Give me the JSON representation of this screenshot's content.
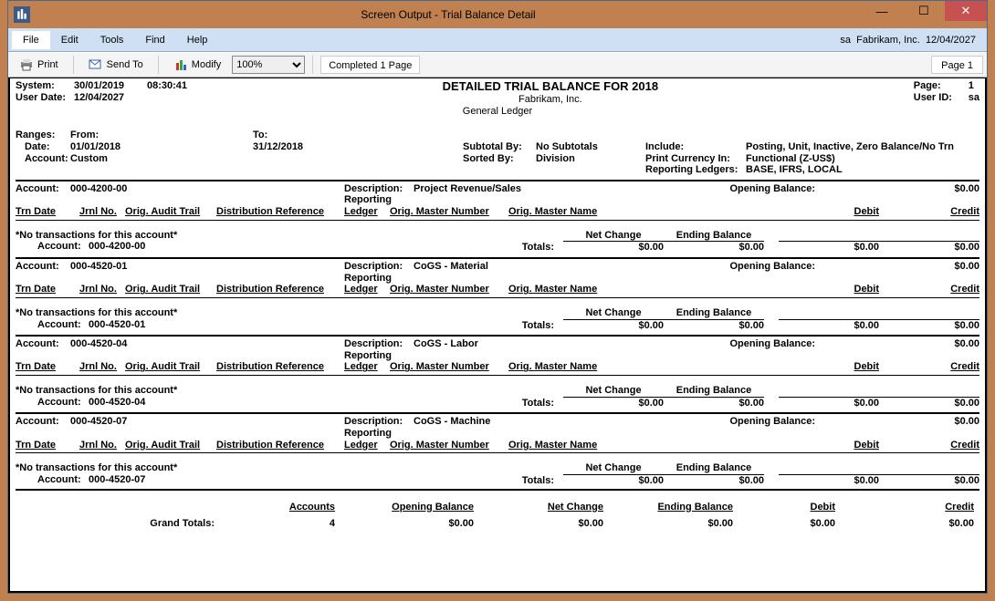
{
  "window": {
    "title": "Screen Output - Trial Balance Detail",
    "min": "—",
    "max": "☐",
    "close": "✕"
  },
  "menubar": {
    "file": "File",
    "edit": "Edit",
    "tools": "Tools",
    "find": "Find",
    "help": "Help",
    "right_user": "sa",
    "right_company": "Fabrikam, Inc.",
    "right_date": "12/04/2027"
  },
  "toolbar": {
    "print": "Print",
    "sendto": "Send To",
    "modify": "Modify",
    "zoom": "100%",
    "status": "Completed 1 Page",
    "pageind": "Page 1"
  },
  "header": {
    "system_lab": "System:",
    "system_date": "30/01/2019",
    "system_time": "08:30:41",
    "userdate_lab": "User Date:",
    "userdate": "12/04/2027",
    "title": "DETAILED TRIAL BALANCE FOR 2018",
    "company": "Fabrikam, Inc.",
    "ledger": "General Ledger",
    "page_lab": "Page:",
    "page": "1",
    "userid_lab": "User ID:",
    "userid": "sa"
  },
  "ranges": {
    "ranges_lab": "Ranges:",
    "from_lab": "From:",
    "to_lab": "To:",
    "date_lab": "Date:",
    "date_from": "01/01/2018",
    "date_to": "31/12/2018",
    "account_lab": "Account:",
    "account_val": "Custom",
    "subtotal_lab": "Subtotal By:",
    "subtotal_val": "No Subtotals",
    "sorted_lab": "Sorted By:",
    "sorted_val": "Division",
    "include_lab": "Include:",
    "include_val": "Posting, Unit, Inactive, Zero Balance/No Trn",
    "curr_lab": "Print Currency In:",
    "curr_val": "Functional (Z-US$)",
    "rl_lab": "Reporting Ledgers:",
    "rl_val": "BASE, IFRS, LOCAL"
  },
  "colheads": {
    "account": "Account:",
    "trn_date": "Trn Date",
    "jrnl": "Jrnl No.",
    "audit": "Orig. Audit Trail",
    "dist": "Distribution Reference",
    "desc": "Description:",
    "reporting": "Reporting",
    "ledger": "Ledger",
    "master_num": "Orig. Master Number",
    "master_name": "Orig. Master Name",
    "opening": "Opening Balance:",
    "debit": "Debit",
    "credit": "Credit",
    "netchange": "Net Change",
    "endbal": "Ending Balance",
    "totals": "Totals:",
    "no_trans": "*No transactions for this account*",
    "account_sub": "Account:"
  },
  "accounts": [
    {
      "id": "000-4200-00",
      "desc": "Project Revenue/Sales",
      "opening": "$0.00",
      "netchange": "$0.00",
      "endbal": "$0.00",
      "debit": "$0.00",
      "credit": "$0.00"
    },
    {
      "id": "000-4520-01",
      "desc": "CoGS - Material",
      "opening": "$0.00",
      "netchange": "$0.00",
      "endbal": "$0.00",
      "debit": "$0.00",
      "credit": "$0.00"
    },
    {
      "id": "000-4520-04",
      "desc": "CoGS - Labor",
      "opening": "$0.00",
      "netchange": "$0.00",
      "endbal": "$0.00",
      "debit": "$0.00",
      "credit": "$0.00"
    },
    {
      "id": "000-4520-07",
      "desc": "CoGS - Machine",
      "opening": "$0.00",
      "netchange": "$0.00",
      "endbal": "$0.00",
      "debit": "$0.00",
      "credit": "$0.00"
    }
  ],
  "grand": {
    "lab": "Grand Totals:",
    "accounts_lab": "Accounts",
    "opening_lab": "Opening Balance",
    "netchange_lab": "Net Change",
    "endbal_lab": "Ending Balance",
    "debit_lab": "Debit",
    "credit_lab": "Credit",
    "accounts": "4",
    "opening": "$0.00",
    "netchange": "$0.00",
    "endbal": "$0.00",
    "debit": "$0.00",
    "credit": "$0.00"
  }
}
